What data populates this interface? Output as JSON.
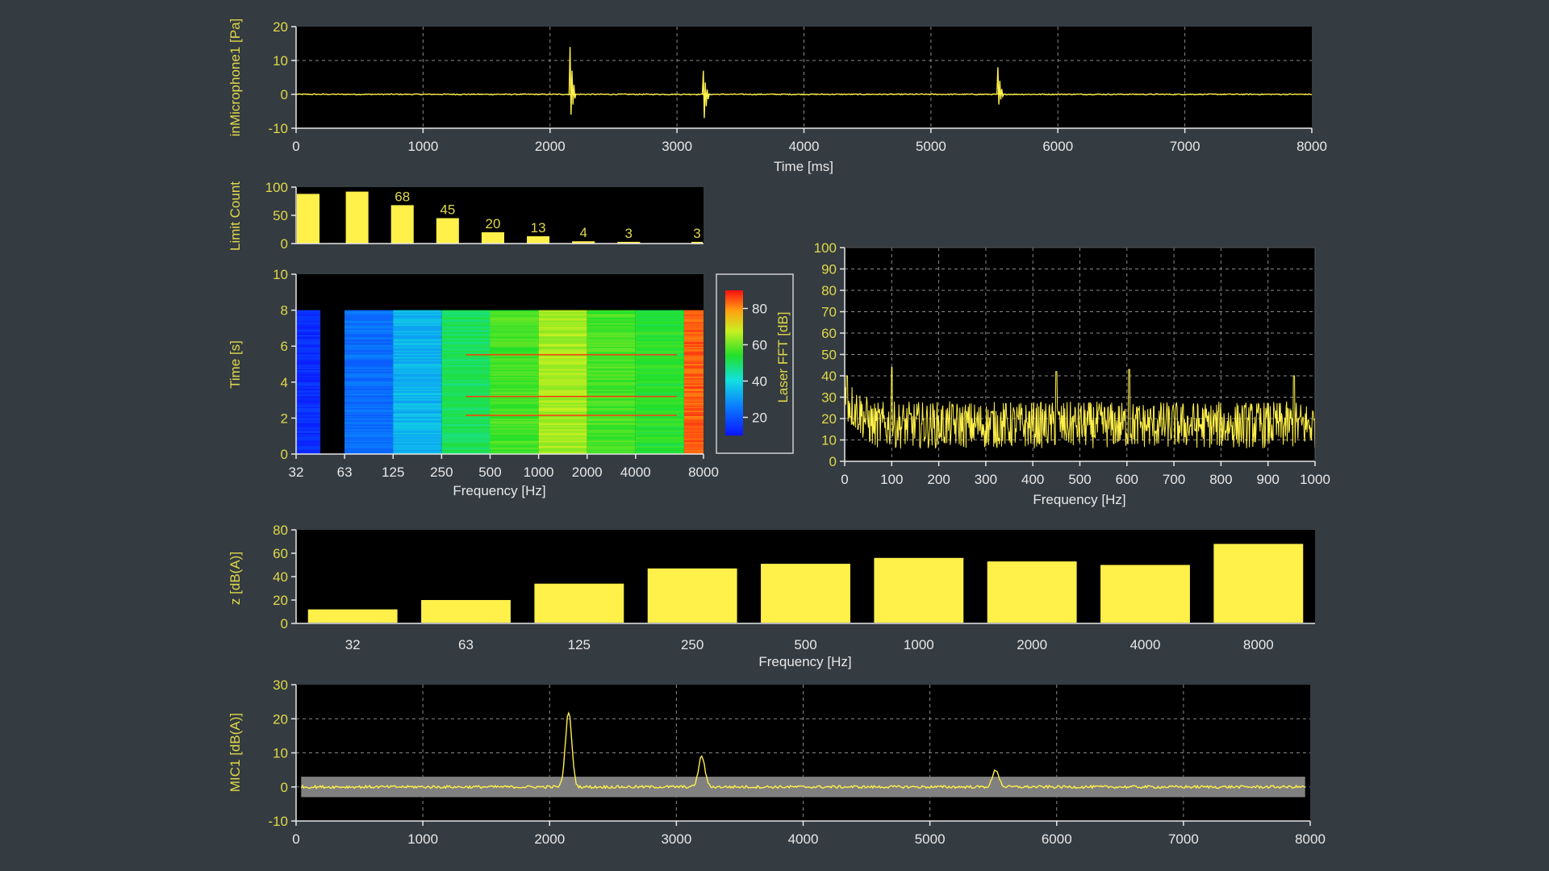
{
  "theme": {
    "background": "#343b41",
    "plot_background": "#000000",
    "axis_color": "#e8e8e8",
    "accent_yellow": "#fff04a",
    "label_yellow": "#e0d84a",
    "grid_color": "#8a8a8a",
    "band_gray": "#808080"
  },
  "chart_data": [
    {
      "id": "microphone-time",
      "type": "line",
      "xlabel": "Time [ms]",
      "ylabel": "inMicrophone1 [Pa]",
      "xlim": [
        0,
        8000
      ],
      "ylim": [
        -10,
        20
      ],
      "xticks": [
        0,
        1000,
        2000,
        3000,
        4000,
        5000,
        6000,
        7000,
        8000
      ],
      "yticks": [
        -10,
        0,
        10,
        20
      ],
      "grid": true,
      "baseline": 0,
      "noise_amplitude": 0.3,
      "events": [
        {
          "t": 2150,
          "up": 14,
          "down": -6
        },
        {
          "t": 3200,
          "up": 7,
          "down": -7
        },
        {
          "t": 5520,
          "up": 8,
          "down": -3
        }
      ]
    },
    {
      "id": "limit-count",
      "type": "bar",
      "ylabel": "Limit Count",
      "ylim": [
        0,
        100
      ],
      "yticks": [
        0,
        50,
        100
      ],
      "bars": [
        {
          "value": 88,
          "label": ""
        },
        {
          "value": 92,
          "label": ""
        },
        {
          "value": 68,
          "label": "68"
        },
        {
          "value": 45,
          "label": "45"
        },
        {
          "value": 20,
          "label": "20"
        },
        {
          "value": 13,
          "label": "13"
        },
        {
          "value": 4,
          "label": "4"
        },
        {
          "value": 3,
          "label": "3"
        },
        {
          "value": 3,
          "label": "3"
        }
      ]
    },
    {
      "id": "spectrogram",
      "type": "heatmap",
      "xlabel": "Frequency [Hz]",
      "ylabel": "Time [s]",
      "categories": [
        "32",
        "63",
        "125",
        "250",
        "500",
        "1000",
        "2000",
        "4000",
        "8000"
      ],
      "ylim": [
        0,
        10
      ],
      "yticks": [
        0,
        2,
        4,
        6,
        8,
        10
      ],
      "data_time_max": 8,
      "band_levels_db": [
        14,
        24,
        34,
        50,
        57,
        65,
        57,
        54,
        84
      ],
      "colorbar": {
        "label": "Laser FFT [dB]",
        "range": [
          10,
          90
        ],
        "ticks": [
          20,
          40,
          60,
          80
        ]
      },
      "event_lines_s": [
        2.15,
        3.2,
        5.52
      ]
    },
    {
      "id": "laser-fft",
      "type": "line",
      "xlabel": "Frequency [Hz]",
      "xlim": [
        0,
        1000
      ],
      "ylim": [
        0,
        100
      ],
      "xticks": [
        0,
        100,
        200,
        300,
        400,
        500,
        600,
        700,
        800,
        900,
        1000
      ],
      "yticks": [
        0,
        10,
        20,
        30,
        40,
        50,
        60,
        70,
        80,
        90,
        100
      ],
      "grid": true,
      "mean_level": 17,
      "peaks": [
        {
          "x": 5,
          "y": 40
        },
        {
          "x": 100,
          "y": 44
        },
        {
          "x": 450,
          "y": 42
        },
        {
          "x": 605,
          "y": 43
        },
        {
          "x": 955,
          "y": 40
        }
      ]
    },
    {
      "id": "octave-levels",
      "type": "bar",
      "xlabel": "Frequency [Hz]",
      "ylabel": "z [dB(A)]",
      "ylim": [
        0,
        80
      ],
      "yticks": [
        0,
        20,
        40,
        60,
        80
      ],
      "categories": [
        "32",
        "63",
        "125",
        "250",
        "500",
        "1000",
        "2000",
        "4000",
        "8000"
      ],
      "values": [
        12,
        20,
        34,
        47,
        51,
        56,
        53,
        50,
        68
      ]
    },
    {
      "id": "mic1-level",
      "type": "line",
      "ylabel": "MIC1 [dB(A)]",
      "xlim": [
        0,
        8000
      ],
      "ylim": [
        -10,
        30
      ],
      "xticks": [
        0,
        1000,
        2000,
        3000,
        4000,
        5000,
        6000,
        7000,
        8000
      ],
      "yticks": [
        -10,
        0,
        10,
        20,
        30
      ],
      "grid": true,
      "tolerance_band": [
        -3,
        3
      ],
      "peaks": [
        {
          "t": 2150,
          "y": 22
        },
        {
          "t": 3200,
          "y": 9
        },
        {
          "t": 5520,
          "y": 5
        }
      ]
    }
  ]
}
